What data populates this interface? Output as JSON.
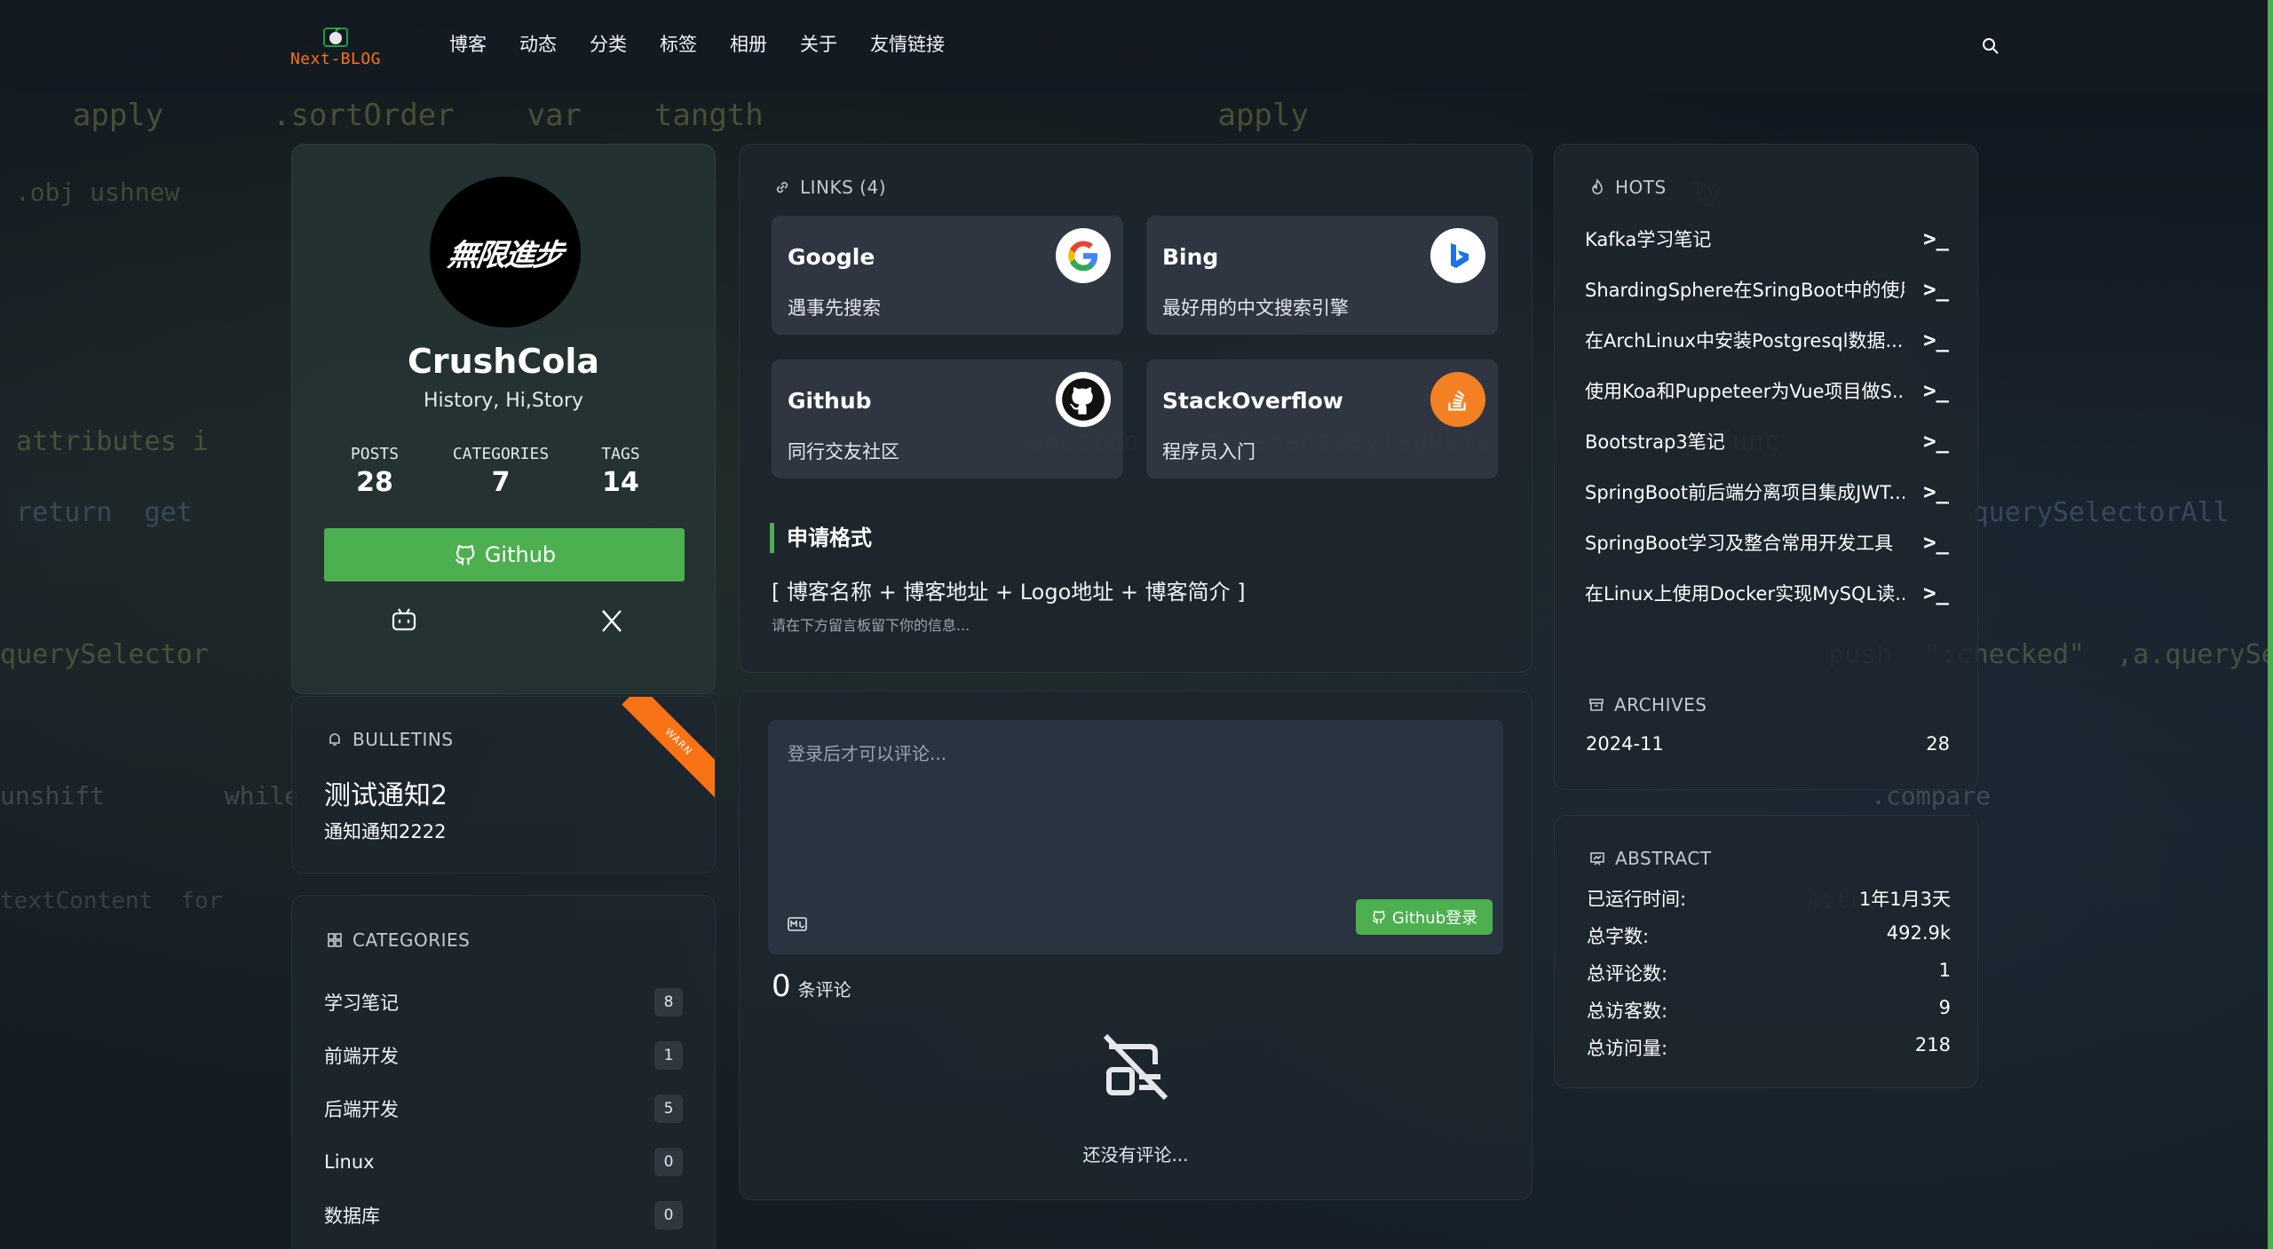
{
  "site": {
    "brand": "Next-BLOG"
  },
  "nav": [
    "博客",
    "动态",
    "分类",
    "标签",
    "相册",
    "关于",
    "友情链接"
  ],
  "profile": {
    "avatar_text": "無限進步",
    "name": "CrushCola",
    "motto": "History, Hi,Story",
    "stats": [
      {
        "label": "POSTS",
        "value": "28"
      },
      {
        "label": "CATEGORIES",
        "value": "7"
      },
      {
        "label": "TAGS",
        "value": "14"
      }
    ],
    "github_label": "Github"
  },
  "bulletins": {
    "title": "BULLETINS",
    "ribbon": "WARN",
    "item_title": "测试通知2",
    "item_body": "通知通知2222"
  },
  "categories": {
    "title": "CATEGORIES",
    "items": [
      {
        "name": "学习笔记",
        "count": "8"
      },
      {
        "name": "前端开发",
        "count": "1"
      },
      {
        "name": "后端开发",
        "count": "5"
      },
      {
        "name": "Linux",
        "count": "0"
      },
      {
        "name": "数据库",
        "count": "0"
      }
    ]
  },
  "links": {
    "title": "LINKS (4)",
    "items": [
      {
        "name": "Google",
        "desc": "遇事先搜索",
        "icon": "google-icon"
      },
      {
        "name": "Bing",
        "desc": "最好用的中文搜索引擎",
        "icon": "bing-icon"
      },
      {
        "name": "Github",
        "desc": "同行交友社区",
        "icon": "github-icon"
      },
      {
        "name": "StackOverflow",
        "desc": "程序员入门",
        "icon": "stackoverflow-icon"
      }
    ],
    "apply_title": "申请格式",
    "apply_format": "[ 博客名称 + 博客地址 + Logo地址 + 博客简介 ]",
    "apply_hint": "请在下方留言板留下你的信息..."
  },
  "comments": {
    "placeholder": "登录后才可以评论...",
    "login_label": "Github登录",
    "count": "0",
    "count_label": "条评论",
    "empty_text": "还没有评论..."
  },
  "hots": {
    "title": "HOTS",
    "arrow": ">_",
    "items": [
      "Kafka学习笔记",
      "ShardingSphere在SringBoot中的使用",
      "在ArchLinux中安装Postgresql数据...",
      "使用Koa和Puppeteer为Vue项目做S...",
      "Bootstrap3笔记",
      "SpringBoot前后端分离项目集成JWT...",
      "SpringBoot学习及整合常用开发工具",
      "在Linux上使用Docker实现MySQL读..."
    ]
  },
  "archives": {
    "title": "ARCHIVES",
    "items": [
      {
        "month": "2024-11",
        "count": "28"
      }
    ]
  },
  "abstract": {
    "title": "ABSTRACT",
    "rows": [
      {
        "label": "已运行时间:",
        "value": "1年1月3天"
      },
      {
        "label": "总字数:",
        "value": "492.9k"
      },
      {
        "label": "总评论数:",
        "value": "1"
      },
      {
        "label": "总访客数:",
        "value": "9"
      },
      {
        "label": "总访问量:",
        "value": "218"
      }
    ]
  },
  "colors": {
    "accent": "#4caf50",
    "brand": "#f97316"
  }
}
